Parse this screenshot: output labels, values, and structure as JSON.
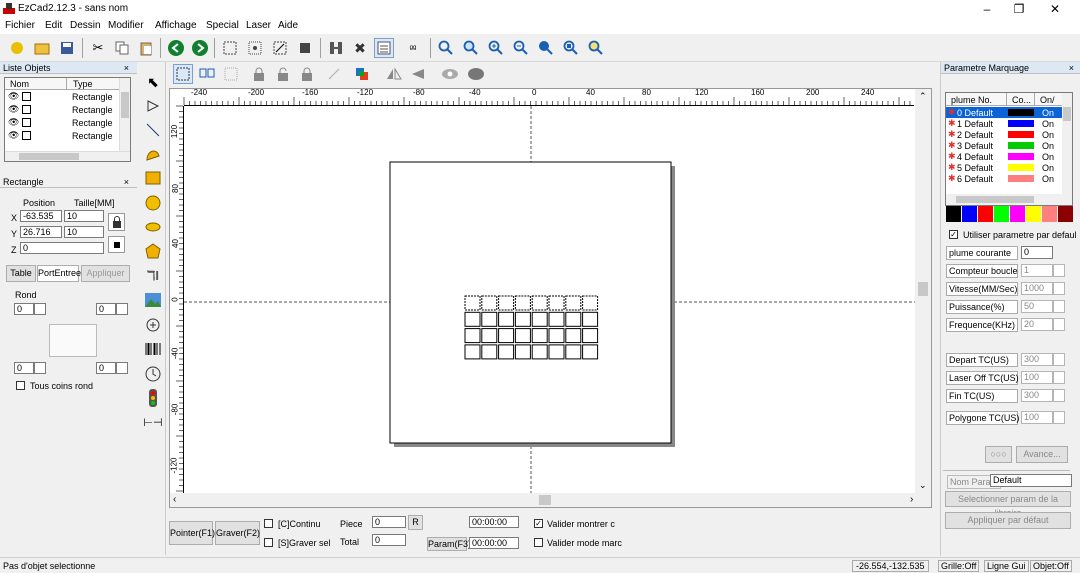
{
  "title_bar": {
    "title": "EzCad2.12.3 - sans nom",
    "minimize": "–",
    "restore": "❐",
    "close": "✕"
  },
  "menu": [
    "Fichier",
    "Edit",
    "Dessin",
    "Modifier",
    "Affichage",
    "Special",
    "Laser",
    "Aide"
  ],
  "objects_panel": {
    "title": "Liste Objets",
    "col_name": "Nom",
    "col_type": "Type",
    "rows": [
      "Rectangle",
      "Rectangle",
      "Rectangle",
      "Rectangle"
    ]
  },
  "rect_panel": {
    "title": "Rectangle",
    "position_label": "Position",
    "size_label": "Taille[MM]",
    "x_label": "X",
    "y_label": "Y",
    "z_label": "Z",
    "x": "-63.535",
    "y": "26.716",
    "z": "0",
    "w": "10",
    "h": "10",
    "tab_table": "Table",
    "tab_port": "PortEntree",
    "apply": "Appliquer",
    "rond": "Rond",
    "r1": "0",
    "r2": "0",
    "r3": "0",
    "r4": "0",
    "all_corners": "Tous coins rond"
  },
  "ruler": {
    "h": [
      "-240",
      "-200",
      "-160",
      "-120",
      "-80",
      "-40",
      "0",
      "40",
      "80",
      "120",
      "160",
      "200",
      "240"
    ],
    "v": [
      "120",
      "80",
      "40",
      "0",
      "-40",
      "-80",
      "-120"
    ]
  },
  "bottom": {
    "pointer": "Pointer(F1)",
    "graver": "Graver(F2)",
    "continu": "[C]Continu",
    "graver_sel": "[S]Graver sel",
    "piece_label": "Piece",
    "piece": "0",
    "total_label": "Total",
    "total": "0",
    "r": "R",
    "time1": "00:00:00",
    "time2": "00:00:00",
    "param": "Param(F3)",
    "valider_montrer": "Valider montrer c",
    "valider_mode": "Valider mode marc"
  },
  "params": {
    "title": "Parametre Marquage",
    "col_pen": "plume No.",
    "col_color": "Co...",
    "col_on": "On/",
    "pens": [
      {
        "name": "0 Default",
        "color": "#000000",
        "on": "On"
      },
      {
        "name": "1 Default",
        "color": "#0000ff",
        "on": "On"
      },
      {
        "name": "2 Default",
        "color": "#ff0000",
        "on": "On"
      },
      {
        "name": "3 Default",
        "color": "#00cc00",
        "on": "On"
      },
      {
        "name": "4 Default",
        "color": "#ff00ff",
        "on": "On"
      },
      {
        "name": "5 Default",
        "color": "#ffff00",
        "on": "On"
      },
      {
        "name": "6 Default",
        "color": "#ff7f7f",
        "on": "On"
      }
    ],
    "palette": [
      "#000000",
      "#0000ff",
      "#ff0000",
      "#00ff00",
      "#ff00ff",
      "#ffff00",
      "#ff8080",
      "#8b0000"
    ],
    "use_default": "Utiliser parametre par defaul",
    "fields": [
      {
        "label": "plume courante",
        "value": "0"
      },
      {
        "label": "Compteur boucle",
        "value": "1"
      },
      {
        "label": "Vitesse(MM/Sec)",
        "value": "1000"
      },
      {
        "label": "Puissance(%)",
        "value": "50"
      },
      {
        "label": "Frequence(KHz)",
        "value": "20"
      },
      {
        "label": "Depart TC(US)",
        "value": "300"
      },
      {
        "label": "Laser Off TC(US)",
        "value": "100"
      },
      {
        "label": "Fin TC(US)",
        "value": "300"
      },
      {
        "label": "Polygone TC(US)",
        "value": "100"
      }
    ],
    "advanced": "Avance...",
    "nom_param": "Nom Param",
    "param_name": "Default",
    "select_lib": "Selectionner param de la libraire",
    "apply_default": "Appliquer par défaut"
  },
  "status": {
    "left": "Pas d'objet selectionne",
    "coords": "-26.554,-132.535",
    "grid": "Grille:Off",
    "guide": "Ligne Gui",
    "obj": "Objet:Off"
  }
}
